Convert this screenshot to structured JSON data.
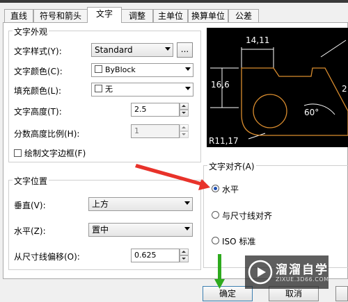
{
  "tabs": [
    "直线",
    "符号和箭头",
    "文字",
    "调整",
    "主单位",
    "换算单位",
    "公差"
  ],
  "active_tab": "文字",
  "text_appearance": {
    "title": "文字外观",
    "style_label": "文字样式(Y):",
    "style_value": "Standard",
    "style_more_button": "...",
    "color_label": "文字颜色(C):",
    "color_value": "ByBlock",
    "fill_label": "填充颜色(L):",
    "fill_value": "无",
    "height_label": "文字高度(T):",
    "height_value": "2.5",
    "fraction_label": "分数高度比例(H):",
    "fraction_value": "1",
    "frame_label": "绘制文字边框(F)"
  },
  "text_placement": {
    "title": "文字位置",
    "vertical_label": "垂直(V):",
    "vertical_value": "上方",
    "horizontal_label": "水平(Z):",
    "horizontal_value": "置中",
    "offset_label": "从尺寸线偏移(O):",
    "offset_value": "0.625"
  },
  "text_alignment": {
    "title": "文字对齐(A)",
    "options": [
      "水平",
      "与尺寸线对齐",
      "ISO 标准"
    ],
    "selected": "水平"
  },
  "preview": {
    "dim_top": "14,11",
    "dim_left": "16,6",
    "dim_angle": "60°",
    "dim_radius": "R11,17",
    "dim_right_partial": "2"
  },
  "buttons": {
    "ok": "确定",
    "cancel": "取消"
  },
  "watermark": {
    "title": "溜溜自学",
    "url": "ZIXUE.3D66.COM"
  },
  "colors": {
    "annotation_arrow": "#e8322a",
    "confirm_arrow": "#2eaa1e",
    "preview_bg": "#000000",
    "drawing_lines": "#ffffff",
    "drawing_shape": "#d98c2e"
  }
}
